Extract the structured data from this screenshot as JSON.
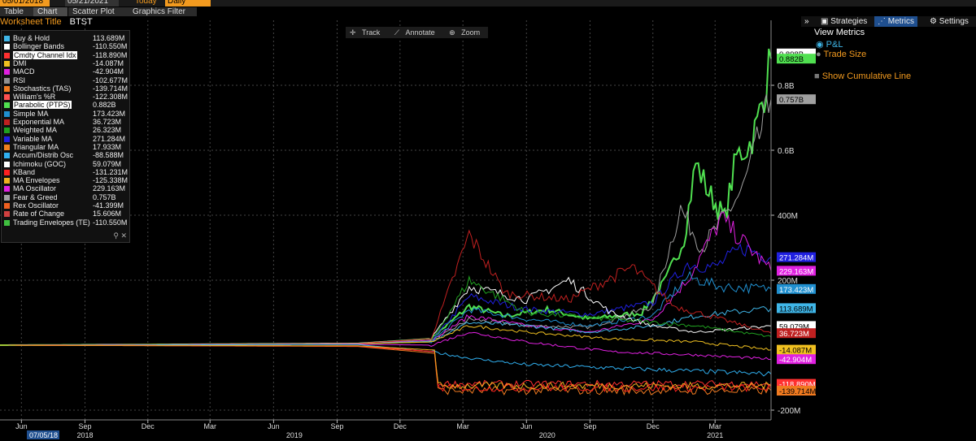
{
  "topbar": {
    "start_date": "05/01/2018",
    "end_date": "05/21/2021",
    "today_label": "Today",
    "frequency": "Daily"
  },
  "tabs": [
    "Table",
    "Chart",
    "Scatter Plot",
    "Graphics Filter"
  ],
  "worksheet": {
    "label": "Worksheet Title",
    "value": "BTST"
  },
  "tools": {
    "track": "Track",
    "annotate": "Annotate",
    "zoom": "Zoom"
  },
  "side": {
    "expand": "»",
    "strategies": "Strategies",
    "metrics": "Metrics",
    "settings": "Settings",
    "view_metrics_title": "View Metrics",
    "pnl": "P&L",
    "trade_size": "Trade Size",
    "show_cumulative": "Show Cumulative Line"
  },
  "legend": [
    {
      "name": "Buy & Hold",
      "value": "113.689M",
      "color": "#3fb6e8"
    },
    {
      "name": "Bollinger Bands",
      "value": "-110.550M",
      "color": "#ffffff"
    },
    {
      "name": "Cmdty Channel Idx",
      "value": "-118.890M",
      "color": "#ff3030"
    },
    {
      "name": "DMI",
      "value": "-14.087M",
      "color": "#f0c020"
    },
    {
      "name": "MACD",
      "value": "-42.904M",
      "color": "#e020e0"
    },
    {
      "name": "RSI",
      "value": "-102.677M",
      "color": "#909090"
    },
    {
      "name": "Stochastics (TAS)",
      "value": "-139.714M",
      "color": "#f07a20"
    },
    {
      "name": "William's %R",
      "value": "-122.308M",
      "color": "#ff5050"
    },
    {
      "name": "Parabolic (PTPS)",
      "value": "0.882B",
      "color": "#50e050"
    },
    {
      "name": "Simple MA",
      "value": "173.423M",
      "color": "#2090d0"
    },
    {
      "name": "Exponential MA",
      "value": "36.723M",
      "color": "#c02020"
    },
    {
      "name": "Weighted MA",
      "value": "26.323M",
      "color": "#20a020"
    },
    {
      "name": "Variable MA",
      "value": "271.284M",
      "color": "#2020e0"
    },
    {
      "name": "Triangular MA",
      "value": "17.933M",
      "color": "#f08020"
    },
    {
      "name": "Accum/Distrib Osc",
      "value": "-88.588M",
      "color": "#30b0f0"
    },
    {
      "name": "Ichimoku (GOC)",
      "value": "59.079M",
      "color": "#ffffff"
    },
    {
      "name": "KBand",
      "value": "-131.231M",
      "color": "#ff2020"
    },
    {
      "name": "MA Envelopes",
      "value": "-125.338M",
      "color": "#f0b020"
    },
    {
      "name": "MA Oscillator",
      "value": "229.163M",
      "color": "#e020e0"
    },
    {
      "name": "Fear & Greed",
      "value": "0.757B",
      "color": "#a0a0a0"
    },
    {
      "name": "Rex Oscillator",
      "value": "-41.399M",
      "color": "#f06020"
    },
    {
      "name": "Rate of Change",
      "value": "15.606M",
      "color": "#d04040"
    },
    {
      "name": "Trading Envelopes (TE)",
      "value": "-110.550M",
      "color": "#40c040"
    }
  ],
  "chart_data": {
    "type": "line",
    "x_range": [
      "2018-05-01",
      "2021-05-21"
    ],
    "ylim": [
      -230,
      1000
    ],
    "y_unit": "M",
    "y_ticks": [
      {
        "v": -200,
        "label": "-200M"
      },
      {
        "v": 200,
        "label": "200M"
      },
      {
        "v": 400,
        "label": "400M"
      },
      {
        "v": 600,
        "label": "0.6B"
      },
      {
        "v": 800,
        "label": "0.8B"
      }
    ],
    "x_month_ticks": [
      {
        "date": "2018-06-01",
        "label": "Jun"
      },
      {
        "date": "2018-09-01",
        "label": "Sep"
      },
      {
        "date": "2018-12-01",
        "label": "Dec"
      },
      {
        "date": "2019-03-01",
        "label": "Mar"
      },
      {
        "date": "2019-06-01",
        "label": "Jun"
      },
      {
        "date": "2019-09-01",
        "label": "Sep"
      },
      {
        "date": "2019-12-01",
        "label": "Dec"
      },
      {
        "date": "2020-03-01",
        "label": "Mar"
      },
      {
        "date": "2020-06-01",
        "label": "Jun"
      },
      {
        "date": "2020-09-01",
        "label": "Sep"
      },
      {
        "date": "2020-12-01",
        "label": "Dec"
      },
      {
        "date": "2021-03-01",
        "label": "Mar"
      }
    ],
    "x_year_labels": [
      {
        "date": "2018-09-01",
        "label": "2018"
      },
      {
        "date": "2019-07-01",
        "label": "2019"
      },
      {
        "date": "2020-07-01",
        "label": "2020"
      },
      {
        "date": "2021-03-01",
        "label": "2021"
      }
    ],
    "cursor_date_label": "07/05/18",
    "end_labels": [
      {
        "label": "0.898B",
        "v": 898,
        "bg": "#ffffff",
        "fg": "#000000"
      },
      {
        "label": "0.882B",
        "v": 882,
        "bg": "#50e050",
        "fg": "#000000"
      },
      {
        "label": "0.757B",
        "v": 757,
        "bg": "#a0a0a0",
        "fg": "#000000"
      },
      {
        "label": "271.284M",
        "v": 271,
        "bg": "#2020e0",
        "fg": "#ffffff"
      },
      {
        "label": "229.163M",
        "v": 229,
        "bg": "#e020e0",
        "fg": "#ffffff"
      },
      {
        "label": "173.423M",
        "v": 173,
        "bg": "#2090d0",
        "fg": "#ffffff"
      },
      {
        "label": "113.689M",
        "v": 114,
        "bg": "#3fb6e8",
        "fg": "#000000"
      },
      {
        "label": "59.079M",
        "v": 59,
        "bg": "#ffffff",
        "fg": "#000000"
      },
      {
        "label": "36.723M",
        "v": 37,
        "bg": "#c02020",
        "fg": "#ffffff"
      },
      {
        "label": "-14.087M",
        "v": -14,
        "bg": "#f0c020",
        "fg": "#000000"
      },
      {
        "label": "-42.904M",
        "v": -43,
        "bg": "#e020e0",
        "fg": "#ffffff"
      },
      {
        "label": "-118.890M",
        "v": -119,
        "bg": "#ff3030",
        "fg": "#ffffff"
      },
      {
        "label": "-139.714M",
        "v": -140,
        "bg": "#f07a20",
        "fg": "#000000"
      }
    ],
    "series": [
      {
        "name": "Parabolic (PTPS)",
        "color": "#50e050",
        "width": 2,
        "points": [
          [
            "2018-05-01",
            0
          ],
          [
            "2019-10-01",
            5
          ],
          [
            "2020-01-15",
            20
          ],
          [
            "2020-03-10",
            120
          ],
          [
            "2020-05-01",
            90
          ],
          [
            "2020-07-01",
            110
          ],
          [
            "2020-09-01",
            80
          ],
          [
            "2020-11-15",
            100
          ],
          [
            "2020-12-20",
            200
          ],
          [
            "2021-01-15",
            330
          ],
          [
            "2021-02-01",
            560
          ],
          [
            "2021-02-20",
            470
          ],
          [
            "2021-03-15",
            390
          ],
          [
            "2021-04-01",
            580
          ],
          [
            "2021-04-20",
            620
          ],
          [
            "2021-05-01",
            680
          ],
          [
            "2021-05-21",
            882
          ]
        ]
      },
      {
        "name": "Fear & Greed",
        "color": "#a0a0a0",
        "width": 1,
        "points": [
          [
            "2018-05-01",
            0
          ],
          [
            "2019-10-01",
            5
          ],
          [
            "2020-01-15",
            10
          ],
          [
            "2020-03-10",
            80
          ],
          [
            "2020-06-01",
            60
          ],
          [
            "2020-09-01",
            55
          ],
          [
            "2020-12-01",
            120
          ],
          [
            "2021-01-10",
            420
          ],
          [
            "2021-02-10",
            300
          ],
          [
            "2021-03-10",
            380
          ],
          [
            "2021-04-10",
            480
          ],
          [
            "2021-05-21",
            757
          ]
        ]
      },
      {
        "name": "Variable MA",
        "color": "#2020e0",
        "width": 1,
        "points": [
          [
            "2018-05-01",
            0
          ],
          [
            "2019-10-01",
            5
          ],
          [
            "2020-01-15",
            10
          ],
          [
            "2020-03-10",
            150
          ],
          [
            "2020-06-01",
            110
          ],
          [
            "2020-09-01",
            95
          ],
          [
            "2020-12-01",
            130
          ],
          [
            "2021-01-20",
            250
          ],
          [
            "2021-03-01",
            240
          ],
          [
            "2021-04-10",
            300
          ],
          [
            "2021-05-21",
            271
          ]
        ]
      },
      {
        "name": "MA Oscillator",
        "color": "#e020e0",
        "width": 1,
        "points": [
          [
            "2018-05-01",
            0
          ],
          [
            "2019-10-01",
            5
          ],
          [
            "2020-01-15",
            15
          ],
          [
            "2020-03-10",
            90
          ],
          [
            "2020-06-01",
            60
          ],
          [
            "2020-09-01",
            40
          ],
          [
            "2020-12-01",
            80
          ],
          [
            "2021-01-20",
            200
          ],
          [
            "2021-03-10",
            390
          ],
          [
            "2021-04-10",
            320
          ],
          [
            "2021-05-21",
            229
          ]
        ]
      },
      {
        "name": "Simple MA",
        "color": "#2090d0",
        "width": 1,
        "points": [
          [
            "2018-05-01",
            0
          ],
          [
            "2019-10-01",
            5
          ],
          [
            "2020-01-15",
            10
          ],
          [
            "2020-03-10",
            110
          ],
          [
            "2020-06-01",
            80
          ],
          [
            "2020-09-01",
            60
          ],
          [
            "2020-12-01",
            90
          ],
          [
            "2021-01-20",
            210
          ],
          [
            "2021-03-10",
            180
          ],
          [
            "2021-05-21",
            173
          ]
        ]
      },
      {
        "name": "Buy & Hold",
        "color": "#3fb6e8",
        "width": 1,
        "points": [
          [
            "2018-05-01",
            0
          ],
          [
            "2019-10-01",
            5
          ],
          [
            "2020-01-15",
            12
          ],
          [
            "2020-03-10",
            70
          ],
          [
            "2020-06-01",
            60
          ],
          [
            "2020-09-01",
            40
          ],
          [
            "2020-12-01",
            60
          ],
          [
            "2021-02-01",
            90
          ],
          [
            "2021-05-21",
            114
          ]
        ]
      },
      {
        "name": "Ichimoku (GOC)",
        "color": "#ffffff",
        "width": 1,
        "points": [
          [
            "2018-05-01",
            0
          ],
          [
            "2019-10-01",
            6
          ],
          [
            "2020-01-15",
            20
          ],
          [
            "2020-03-10",
            180
          ],
          [
            "2020-06-01",
            140
          ],
          [
            "2020-08-01",
            200
          ],
          [
            "2020-10-01",
            100
          ],
          [
            "2020-12-01",
            60
          ],
          [
            "2021-02-01",
            40
          ],
          [
            "2021-05-21",
            59
          ]
        ]
      },
      {
        "name": "Exponential MA",
        "color": "#c02020",
        "width": 1,
        "points": [
          [
            "2018-05-01",
            0
          ],
          [
            "2019-10-01",
            5
          ],
          [
            "2020-01-15",
            20
          ],
          [
            "2020-03-10",
            340
          ],
          [
            "2020-05-01",
            160
          ],
          [
            "2020-08-01",
            140
          ],
          [
            "2020-11-01",
            240
          ],
          [
            "2021-01-01",
            120
          ],
          [
            "2021-05-21",
            37
          ]
        ]
      },
      {
        "name": "Weighted MA",
        "color": "#20a020",
        "width": 1,
        "points": [
          [
            "2018-05-01",
            0
          ],
          [
            "2019-10-01",
            4
          ],
          [
            "2020-01-15",
            10
          ],
          [
            "2020-03-10",
            200
          ],
          [
            "2020-06-01",
            100
          ],
          [
            "2020-10-01",
            80
          ],
          [
            "2021-02-01",
            60
          ],
          [
            "2021-05-21",
            26
          ]
        ]
      },
      {
        "name": "DMI",
        "color": "#f0c020",
        "width": 1,
        "points": [
          [
            "2018-05-01",
            0
          ],
          [
            "2019-10-01",
            4
          ],
          [
            "2020-01-15",
            10
          ],
          [
            "2020-03-10",
            60
          ],
          [
            "2020-06-01",
            40
          ],
          [
            "2020-10-01",
            20
          ],
          [
            "2021-02-01",
            10
          ],
          [
            "2021-05-21",
            -14
          ]
        ]
      },
      {
        "name": "MACD",
        "color": "#e020e0",
        "width": 1,
        "points": [
          [
            "2018-05-01",
            0
          ],
          [
            "2019-10-01",
            3
          ],
          [
            "2020-01-15",
            0
          ],
          [
            "2020-03-10",
            40
          ],
          [
            "2020-06-01",
            10
          ],
          [
            "2020-10-01",
            -20
          ],
          [
            "2021-02-01",
            -30
          ],
          [
            "2021-05-21",
            -43
          ]
        ]
      },
      {
        "name": "Accum/Distrib Osc",
        "color": "#30b0f0",
        "width": 1,
        "points": [
          [
            "2018-05-01",
            0
          ],
          [
            "2019-10-01",
            2
          ],
          [
            "2020-01-15",
            -20
          ],
          [
            "2020-03-10",
            -40
          ],
          [
            "2020-06-01",
            -60
          ],
          [
            "2020-10-01",
            -70
          ],
          [
            "2021-02-01",
            -80
          ],
          [
            "2021-05-21",
            -89
          ]
        ]
      },
      {
        "name": "Cmdty Channel Idx",
        "color": "#ff3030",
        "width": 1,
        "points": [
          [
            "2018-05-01",
            0
          ],
          [
            "2019-10-01",
            -3
          ],
          [
            "2020-01-20",
            -20
          ],
          [
            "2020-01-25",
            -119
          ],
          [
            "2021-05-21",
            -119
          ]
        ]
      },
      {
        "name": "Stochastics (TAS)",
        "color": "#f07a20",
        "width": 1,
        "points": [
          [
            "2018-05-01",
            0
          ],
          [
            "2019-10-01",
            -4
          ],
          [
            "2020-01-20",
            -25
          ],
          [
            "2020-01-25",
            -140
          ],
          [
            "2021-05-21",
            -140
          ]
        ]
      },
      {
        "name": "KBand",
        "color": "#ff2020",
        "width": 1,
        "points": [
          [
            "2018-05-01",
            0
          ],
          [
            "2019-10-01",
            -3
          ],
          [
            "2020-01-20",
            -20
          ],
          [
            "2020-01-25",
            -131
          ],
          [
            "2021-05-21",
            -131
          ]
        ]
      },
      {
        "name": "MA Envelopes",
        "color": "#f0b020",
        "width": 1,
        "points": [
          [
            "2018-05-01",
            0
          ],
          [
            "2019-10-01",
            -2
          ],
          [
            "2020-01-20",
            -15
          ],
          [
            "2020-01-25",
            -125
          ],
          [
            "2021-05-21",
            -125
          ]
        ]
      }
    ]
  }
}
